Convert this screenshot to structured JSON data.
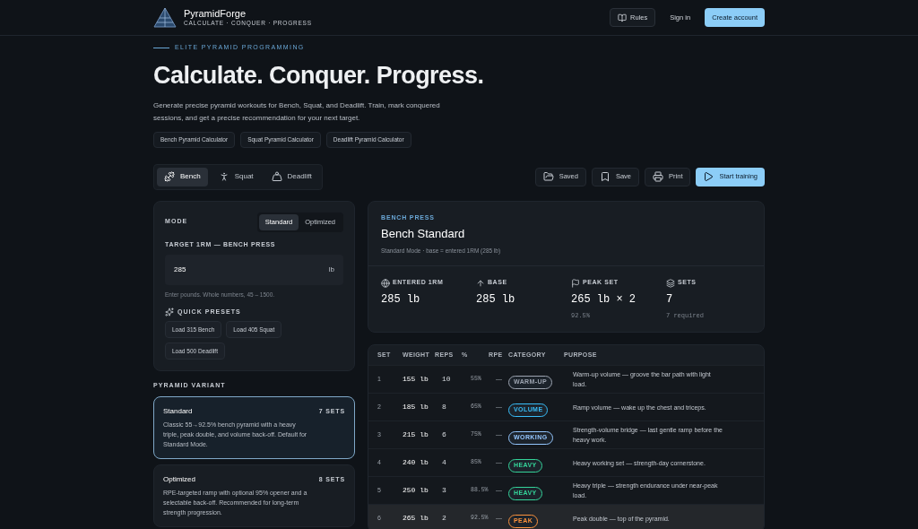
{
  "brand": {
    "name": "PyramidForge",
    "tagline": "CALCULATE · CONQUER · PROGRESS"
  },
  "nav": {
    "rules": "Rules",
    "sign_in": "Sign in",
    "create": "Create account"
  },
  "hero": {
    "eyebrow": "ELITE PYRAMID PROGRAMMING",
    "title": "Calculate. Conquer. Progress.",
    "intro": "Generate precise pyramid workouts for Bench, Squat, and Deadlift. Train, mark conquered sessions, and get a precise recommendation for your next target.",
    "links": [
      "Bench Pyramid Calculator",
      "Squat Pyramid Calculator",
      "Deadlift Pyramid Calculator"
    ]
  },
  "lift_tabs": [
    {
      "label": "Bench",
      "selected": true
    },
    {
      "label": "Squat",
      "selected": false
    },
    {
      "label": "Deadlift",
      "selected": false
    }
  ],
  "actions": [
    {
      "label": "Saved",
      "kind": "secondary"
    },
    {
      "label": "Save",
      "kind": "secondary"
    },
    {
      "label": "Print",
      "kind": "secondary"
    },
    {
      "label": "Start training",
      "kind": "primary"
    }
  ],
  "settings": {
    "mode_label": "MODE",
    "modes": [
      {
        "label": "Standard",
        "selected": true
      },
      {
        "label": "Optimized",
        "selected": false
      }
    ],
    "target_label": "TARGET 1RM — BENCH PRESS",
    "target_value": "285",
    "unit": "lb",
    "hint": "Enter pounds. Whole numbers, 45 – 1500.",
    "presets_label": "QUICK PRESETS",
    "presets": [
      "Load 315 Bench",
      "Load 405 Squat",
      "Load 500 Deadlift"
    ]
  },
  "variant_label": "PYRAMID VARIANT",
  "variants": [
    {
      "name": "Standard",
      "sets": "7 SETS",
      "description": "Classic 55→92.5% bench pyramid with a heavy triple, peak double, and volume back-off. Default for Standard Mode.",
      "selected": true
    },
    {
      "name": "Optimized",
      "sets": "8 SETS",
      "description": "RPE-targeted ramp with optional 95% opener and a selectable back-off. Recommended for long-term strength progression.",
      "selected": false
    }
  ],
  "summary": {
    "eyebrow": "BENCH PRESS",
    "title": "Bench Standard",
    "subtitle": "Standard Mode · base = entered 1RM (285 lb)",
    "stats": [
      {
        "label": "ENTERED 1RM",
        "value": "285 lb"
      },
      {
        "label": "BASE",
        "value": "285 lb"
      },
      {
        "label": "PEAK SET",
        "value": "265 lb × 2",
        "note": "92.5%"
      },
      {
        "label": "SETS",
        "value": "7",
        "note": "7 required"
      }
    ]
  },
  "table": {
    "columns": [
      "SET",
      "WEIGHT",
      "REPS",
      "%",
      "RPE",
      "CATEGORY",
      "PURPOSE"
    ],
    "rows": [
      {
        "set": "1",
        "weight": "155 lb",
        "reps": "10",
        "pct": "55%",
        "rpe": "—",
        "category": "WARM-UP",
        "color": "#9ca3af",
        "purpose": "Warm-up volume — groove the bar path with light load.",
        "selected": false
      },
      {
        "set": "2",
        "weight": "185 lb",
        "reps": "8",
        "pct": "65%",
        "rpe": "—",
        "category": "VOLUME",
        "color": "#38bdf8",
        "purpose": "Ramp volume — wake up the chest and triceps.",
        "selected": false
      },
      {
        "set": "3",
        "weight": "215 lb",
        "reps": "6",
        "pct": "75%",
        "rpe": "—",
        "category": "WORKING",
        "color": "#93c5fd",
        "purpose": "Strength-volume bridge — last gentle ramp before the heavy work.",
        "selected": false
      },
      {
        "set": "4",
        "weight": "240 lb",
        "reps": "4",
        "pct": "85%",
        "rpe": "—",
        "category": "HEAVY",
        "color": "#34d399",
        "purpose": "Heavy working set — strength-day cornerstone.",
        "selected": false
      },
      {
        "set": "5",
        "weight": "250 lb",
        "reps": "3",
        "pct": "88.5%",
        "rpe": "—",
        "category": "HEAVY",
        "color": "#34d399",
        "purpose": "Heavy triple — strength endurance under near-peak load.",
        "selected": false
      },
      {
        "set": "6",
        "weight": "265 lb",
        "reps": "2",
        "pct": "92.5%",
        "rpe": "—",
        "category": "PEAK",
        "color": "#fb923c",
        "purpose": "Peak double — top of the pyramid.",
        "selected": true
      }
    ]
  }
}
